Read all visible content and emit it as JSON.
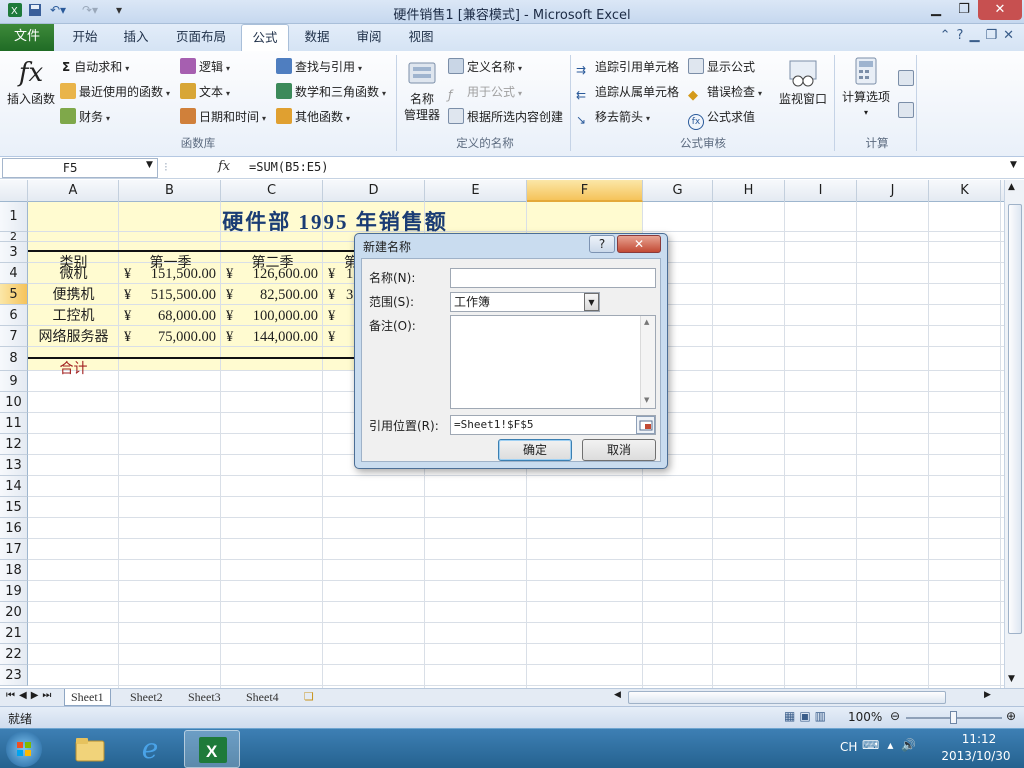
{
  "window": {
    "title": "硬件销售1  [兼容模式] - Microsoft Excel",
    "min_label": "▁",
    "restore_label": "❐",
    "close_label": "✕"
  },
  "tabs": {
    "file": "文件",
    "items": [
      {
        "label": "开始"
      },
      {
        "label": "插入"
      },
      {
        "label": "页面布局"
      },
      {
        "label": "公式"
      },
      {
        "label": "数据"
      },
      {
        "label": "审阅"
      },
      {
        "label": "视图"
      }
    ],
    "active": "公式"
  },
  "ribbon": {
    "insert_function": "插入函数",
    "autosum": "自动求和",
    "recent": "最近使用的函数",
    "financial": "财务",
    "logical": "逻辑",
    "text": "文本",
    "datetime": "日期和时间",
    "lookup": "查找与引用",
    "math": "数学和三角函数",
    "more": "其他函数",
    "group_function_library": "函数库",
    "name_manager_1": "名称",
    "name_manager_2": "管理器",
    "define_name": "定义名称",
    "use_in_formula": "用于公式",
    "create_from_selection": "根据所选内容创建",
    "group_defined_names": "定义的名称",
    "trace_precedents": "追踪引用单元格",
    "trace_dependents": "追踪从属单元格",
    "remove_arrows": "移去箭头",
    "show_formulas": "显示公式",
    "error_checking": "错误检查",
    "evaluate_formula": "公式求值",
    "watch_window": "监视窗口",
    "group_formula_auditing": "公式审核",
    "calc_options": "计算选项",
    "group_calculation": "计算"
  },
  "formula_bar": {
    "name_box": "F5",
    "fx": "fx",
    "formula": "=SUM(B5:E5)"
  },
  "columns": [
    "A",
    "B",
    "C",
    "D",
    "E",
    "F",
    "G",
    "H",
    "I",
    "J",
    "K"
  ],
  "rows": [
    "1",
    "2",
    "3",
    "4",
    "5",
    "6",
    "7",
    "8",
    "9",
    "10",
    "11",
    "12",
    "13",
    "14",
    "15",
    "16",
    "17",
    "18",
    "19",
    "20",
    "21",
    "22",
    "23"
  ],
  "sheet": {
    "title": "硬件部  1995  年销售额",
    "headers": [
      "类别",
      "第一季",
      "第二季"
    ],
    "partial_d3": "第",
    "data": [
      {
        "cat": "微机",
        "b": "151,500.00",
        "c": "126,600.00",
        "d_partial": "1"
      },
      {
        "cat": "便携机",
        "b": "515,500.00",
        "c": "82,500.00",
        "d_partial": "3"
      },
      {
        "cat": "工控机",
        "b": "68,000.00",
        "c": "100,000.00",
        "d_partial": ""
      },
      {
        "cat": "网络服务器",
        "b": "75,000.00",
        "c": "144,000.00",
        "d_partial": ""
      }
    ],
    "yen": "¥",
    "total_label": "合计"
  },
  "sheet_tabs": [
    "Sheet1",
    "Sheet2",
    "Sheet3",
    "Sheet4"
  ],
  "active_sheet": "Sheet1",
  "status": {
    "ready": "就绪",
    "zoom": "100%"
  },
  "dialog": {
    "title": "新建名称",
    "help": "?",
    "name_label": "名称(N):",
    "name_value": "",
    "scope_label": "范围(S):",
    "scope_value": "工作簿",
    "comment_label": "备注(O):",
    "comment_value": "",
    "refers_label": "引用位置(R):",
    "refers_value": "=Sheet1!$F$5",
    "ok": "确定",
    "cancel": "取消"
  },
  "taskbar": {
    "lang": "CH",
    "time": "11:12",
    "date": "2013/10/30"
  },
  "colors": {
    "accent": "#2a5a9a",
    "file_tab": "#2f7d32",
    "header_fill": "#fffbd0",
    "selected_header": "#f5c35a",
    "title_text": "#1a3c74",
    "total_text": "#a11f1f"
  }
}
